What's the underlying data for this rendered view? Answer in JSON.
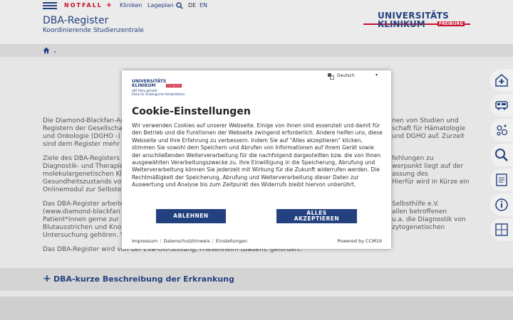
{
  "header": {
    "notfall": "NOTFALL",
    "nav": [
      "Kliniken",
      "Lageplan"
    ],
    "languages": [
      "DE",
      "EN"
    ],
    "title": "DBA-Register",
    "subtitle": "Koordinierende Studienzentrale",
    "logo_line1": "UNIVERSITÄTS",
    "logo_line2": "KLINIKUM",
    "logo_line3": "FREIBURG"
  },
  "content": {
    "para1": [
      {
        "l": "Die Diamond-Blackfan-An",
        "r": "nen von Studien und"
      },
      {
        "l": "Registern der Gesellschaf",
        "r": "schaft für Hämatologie"
      },
      {
        "l": "und Onkologie (DGHO ›)",
        "r": "und DGHO auf. Zurzeit"
      },
      {
        "l": "sind dem Register mehr",
        "r": ""
      }
    ],
    "para2": [
      {
        "l": "Ziele des DBA-Registers",
        "r": "fehlungen zu"
      },
      {
        "l": "Diagnostik- und Therapie",
        "r": "werpunkt liegt auf der"
      },
      {
        "l": "molekulargenetischen Kl",
        "r": "assung des"
      },
      {
        "l": "Gesundheitszustands vo",
        "r": "Hierfür wird in Kürze ein"
      },
      {
        "l": "Onlinemodul zur Selbste",
        "r": ""
      }
    ],
    "para3": [
      {
        "l": "Das DBA-Register arbeite",
        "r": "Selbsthilfe e.V."
      },
      {
        "l": "(www.diamond-blackfan",
        "r": "allen betroffenen"
      },
      {
        "l": "Patient*innen gerne zur ",
        "r": "u.a. die Diagnostik von"
      },
      {
        "l": "Blutausstrichen und Kno",
        "r": "zytogenetischen"
      },
      {
        "l": "Untersuchung gehören. V",
        "r": ""
      }
    ],
    "para4": "Das DBA-Register wird von der Eva-Ott-Stiftung, Friesenheim (Baden), gefördert.",
    "accordion_title": "DBA-kurze Beschreibung der Erkrankung"
  },
  "modal": {
    "logo_line1": "UNIVERSITÄTS",
    "logo_line2": "KLINIKUM",
    "logo_line3": "FREIBURG",
    "logo_sub1": "UKF Reha gGmbH",
    "logo_sub2": "Klinik für Onkologische Rehabilitation",
    "language": "Deutsch",
    "title": "Cookie-Einstellungen",
    "text": "Wir verwenden Cookies auf unserer Webseite. Einige von ihnen sind essenziell und damit für den Betrieb und die Funktionen der Webseite zwingend erforderlich. Andere helfen uns, diese Webseite und Ihre Erfahrung zu verbessern. Indem Sie auf \"Alles akzeptieren\" klicken, stimmen Sie sowohl dem Speichern und Abrufen von Informationen auf Ihrem Gerät sowie der anschließenden Weiterverarbeitung für die nachfolgend dargestellten bzw. die von Ihnen ausgewählten Verarbeitungszwecke zu. Ihre Einwilligung in die Speicherung, Abrufung und Weiterverarbeitung können Sie jederzeit mit Wirkung für die Zukunft widerrufen werden. Die Rechtmäßigkeit der Speicherung, Abrufung und Weiterverarbeitung dieser Daten zur Auswertung und Analyse bis zum Zeitpunkt des Widerrufs bleibt hiervon unberührt.",
    "reject_label": "ABLEHNEN",
    "accept_label": "ALLES AKZEPTIEREN",
    "links": [
      "Impressum",
      "Datenschutzhinweis",
      "Einstellungen"
    ],
    "powered_by": "Powered by CCM19"
  },
  "side_rail_icons": [
    "hospital-plus-icon",
    "bus-icon",
    "virus-icon",
    "search-icon",
    "document-icon",
    "info-icon",
    "sign-language-icon"
  ],
  "colors": {
    "brand_blue": "#24417f",
    "brand_red": "#c8102e"
  }
}
